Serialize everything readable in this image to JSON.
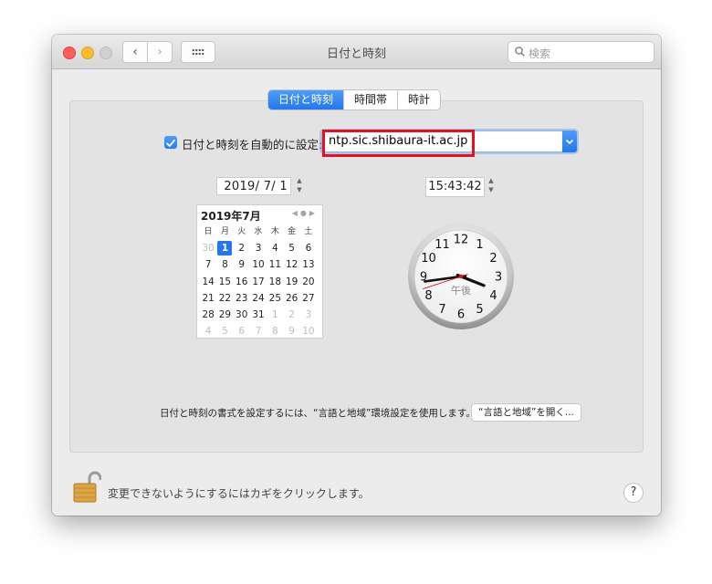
{
  "window": {
    "title": "日付と時刻"
  },
  "search": {
    "placeholder": "検索"
  },
  "tabs": [
    {
      "label": "日付と時刻",
      "active": true
    },
    {
      "label": "時間帯",
      "active": false
    },
    {
      "label": "時計",
      "active": false
    }
  ],
  "auto_set": {
    "checked": true,
    "label": "日付と時刻を自動的に設定:",
    "server": "ntp.sic.shibaura-it.ac.jp"
  },
  "date": {
    "value": "2019/  7/  1"
  },
  "time": {
    "value": "15:43:42"
  },
  "calendar": {
    "title": "2019年7月",
    "weekdays": [
      "日",
      "月",
      "火",
      "水",
      "木",
      "金",
      "土"
    ],
    "weeks": [
      [
        "30",
        "1",
        "2",
        "3",
        "4",
        "5",
        "6"
      ],
      [
        "7",
        "8",
        "9",
        "10",
        "11",
        "12",
        "13"
      ],
      [
        "14",
        "15",
        "16",
        "17",
        "18",
        "19",
        "20"
      ],
      [
        "21",
        "22",
        "23",
        "24",
        "25",
        "26",
        "27"
      ],
      [
        "28",
        "29",
        "30",
        "31",
        "1",
        "2",
        "3"
      ],
      [
        "4",
        "5",
        "6",
        "7",
        "8",
        "9",
        "10"
      ]
    ],
    "selected": "1"
  },
  "clock": {
    "numbers": [
      "12",
      "1",
      "2",
      "3",
      "4",
      "5",
      "6",
      "7",
      "8",
      "9",
      "10",
      "11"
    ],
    "ampm": "午後",
    "hour": 15,
    "minute": 43,
    "second": 42
  },
  "format_note": "日付と時刻の書式を設定するには、“言語と地域”環境設定を使用します。",
  "open_region_button": "“言語と地域”を開く...",
  "lock_text": "変更できないようにするにはカギをクリックします。",
  "help_label": "?",
  "colors": {
    "accent": "#2477ec",
    "highlight": "#e1131c"
  }
}
